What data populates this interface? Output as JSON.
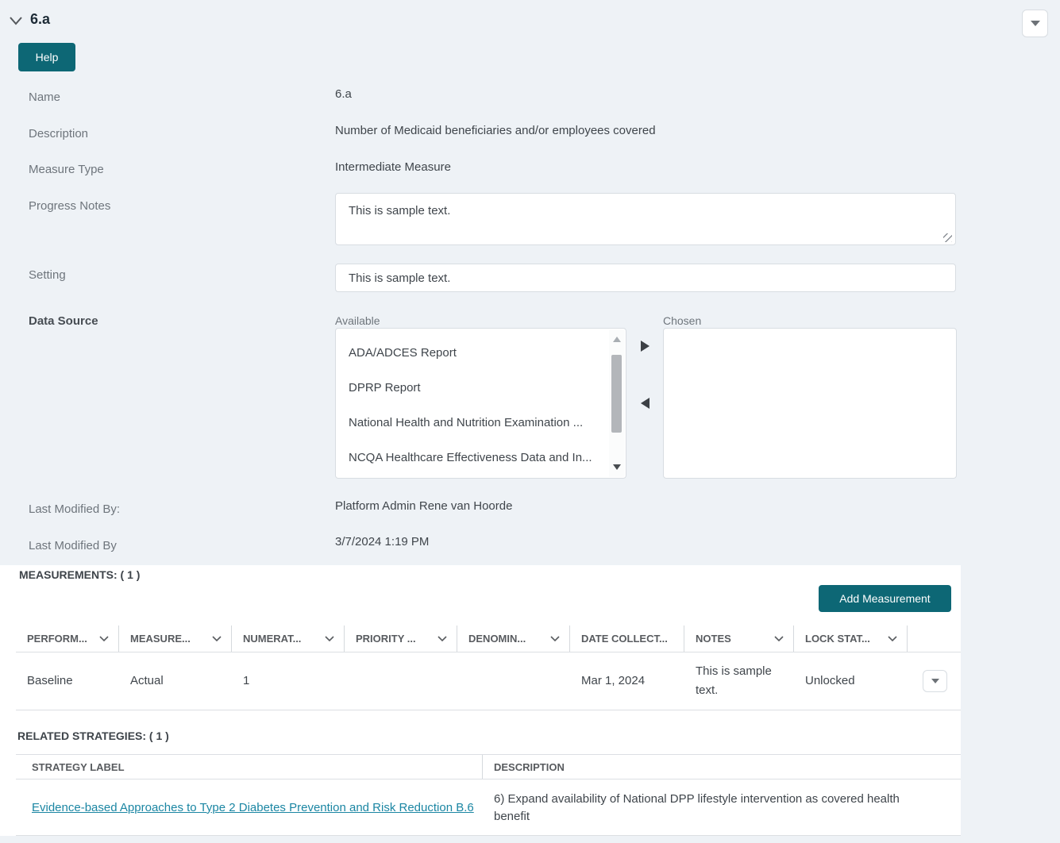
{
  "header": {
    "title": "6.a"
  },
  "help_button_label": "Help",
  "fields": {
    "name": {
      "label": "Name",
      "value": "6.a"
    },
    "description": {
      "label": "Description",
      "value": "Number of Medicaid beneficiaries and/or employees covered"
    },
    "measure_type": {
      "label": "Measure Type",
      "value": "Intermediate Measure"
    },
    "progress_notes": {
      "label": "Progress Notes",
      "value": "This is sample text."
    },
    "setting": {
      "label": "Setting",
      "value": "This is sample text."
    },
    "data_source": {
      "label": "Data Source",
      "available_label": "Available",
      "chosen_label": "Chosen",
      "available_items": [
        "ADA/ADCES Report",
        "DPRP Report",
        "National Health and Nutrition Examination ...",
        "NCQA Healthcare Effectiveness Data and In..."
      ],
      "chosen_items": []
    },
    "last_modified_by_name": {
      "label": "Last Modified By:",
      "value": "Platform Admin Rene van Hoorde"
    },
    "last_modified_by_date": {
      "label": "Last Modified By",
      "value": "3/7/2024 1:19 PM"
    }
  },
  "measurements": {
    "title": "MEASUREMENTS: ( 1 )",
    "add_button_label": "Add Measurement",
    "columns": [
      {
        "label": "PERFORM..."
      },
      {
        "label": "MEASURE..."
      },
      {
        "label": "NUMERAT..."
      },
      {
        "label": "PRIORITY ..."
      },
      {
        "label": "DENOMIN..."
      },
      {
        "label": "DATE COLLECT..."
      },
      {
        "label": "NOTES"
      },
      {
        "label": "LOCK STAT..."
      }
    ],
    "rows": [
      {
        "performance": "Baseline",
        "measure": "Actual",
        "numerator": "1",
        "priority": "",
        "denominator": "",
        "date_collected": "Mar 1, 2024",
        "notes": "This is sample text.",
        "lock_status": "Unlocked"
      }
    ]
  },
  "related_strategies": {
    "title": "RELATED STRATEGIES: ( 1 )",
    "columns": {
      "label": "STRATEGY LABEL",
      "description": "DESCRIPTION"
    },
    "rows": [
      {
        "label": "Evidence-based Approaches to Type 2 Diabetes Prevention and Risk Reduction B.6",
        "description": "6) Expand availability of National DPP lifestyle intervention as covered health benefit"
      }
    ]
  },
  "colors": {
    "accent_teal": "#0d6775",
    "link": "#1b86a3",
    "page_background": "#eef2f6",
    "border": "#dcdfe3"
  }
}
